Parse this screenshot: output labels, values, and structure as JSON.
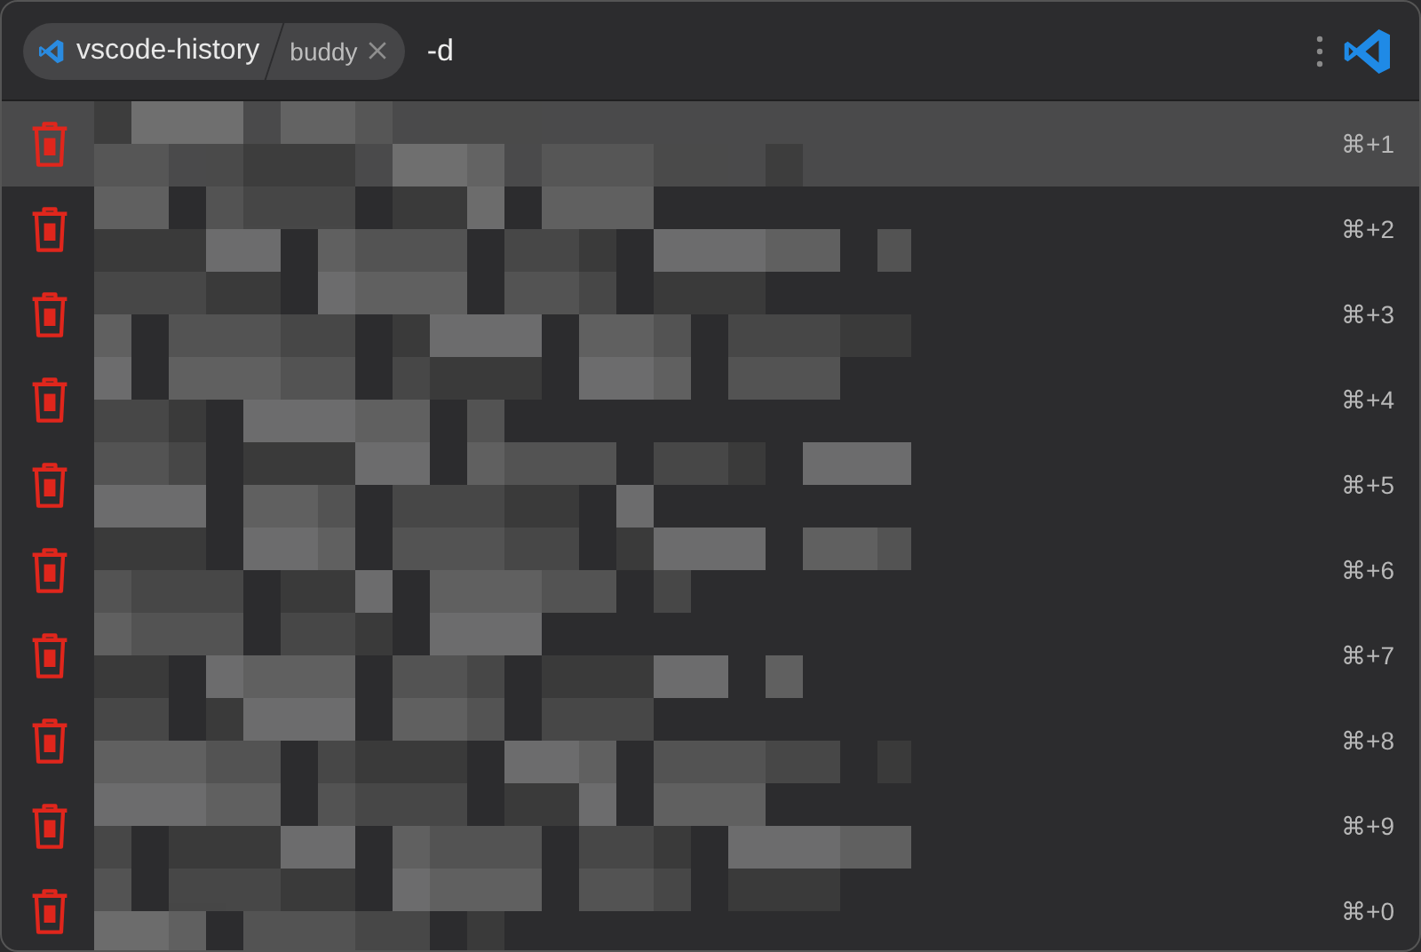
{
  "breadcrumb": {
    "root": "vscode-history",
    "filter": "buddy"
  },
  "search": {
    "value": "-d"
  },
  "rows": [
    {
      "shortcut": "⌘+1",
      "selected": true
    },
    {
      "shortcut": "⌘+2",
      "selected": false
    },
    {
      "shortcut": "⌘+3",
      "selected": false
    },
    {
      "shortcut": "⌘+4",
      "selected": false
    },
    {
      "shortcut": "⌘+5",
      "selected": false
    },
    {
      "shortcut": "⌘+6",
      "selected": false
    },
    {
      "shortcut": "⌘+7",
      "selected": false
    },
    {
      "shortcut": "⌘+8",
      "selected": false
    },
    {
      "shortcut": "⌘+9",
      "selected": false
    },
    {
      "shortcut": "⌘+0",
      "selected": false
    }
  ]
}
